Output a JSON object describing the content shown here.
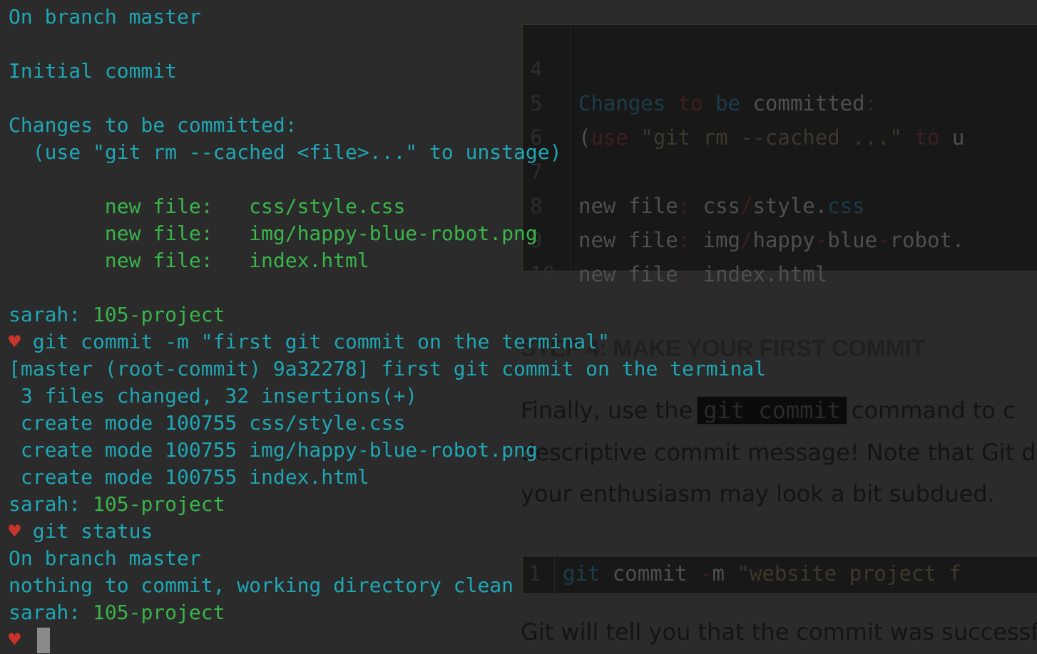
{
  "background_page": {
    "code_block_1": [
      {
        "num": "4",
        "text": ""
      },
      {
        "num": "5",
        "parts": [
          "Changes",
          " ",
          "to",
          " ",
          "be",
          " committed",
          ":"
        ]
      },
      {
        "num": "6",
        "parts": [
          "(",
          "use",
          " \"git rm --cached ...\" ",
          "to",
          " u"
        ]
      },
      {
        "num": "7",
        "text": ""
      },
      {
        "num": "8",
        "parts": [
          "new file",
          ":",
          " css",
          "/",
          "style.",
          "css"
        ]
      },
      {
        "num": "9",
        "parts": [
          "new file",
          ":",
          " img",
          "/",
          "happy",
          "-",
          "blue",
          "-",
          "robot."
        ]
      },
      {
        "num": "10",
        "parts": [
          "new file",
          ":",
          " index.html"
        ]
      }
    ],
    "heading": "STEP 4: MAKE YOUR FIRST COMMIT",
    "para_1_before": "Finally, use the",
    "inline_code": "git commit",
    "para_1_after": "command to c",
    "para_2": "descriptive commit message! Note that Git d",
    "para_3": "your enthusiasm may look a bit subdued.",
    "code_block_2": {
      "num": "1",
      "parts": [
        "git",
        " commit ",
        "-",
        "m ",
        "\"website project f"
      ]
    },
    "para_4": "Git will tell you that the commit was successf"
  },
  "terminal": {
    "lines": [
      {
        "parts": [
          {
            "t": "On branch master",
            "c": "cyan"
          }
        ]
      },
      {
        "parts": []
      },
      {
        "parts": [
          {
            "t": "Initial commit",
            "c": "cyan"
          }
        ]
      },
      {
        "parts": []
      },
      {
        "parts": [
          {
            "t": "Changes to be committed:",
            "c": "cyan"
          }
        ]
      },
      {
        "parts": [
          {
            "t": "  (use \"git rm --cached <file>...\" to unstage)",
            "c": "cyan"
          }
        ]
      },
      {
        "parts": []
      },
      {
        "parts": [
          {
            "t": "        new file:   css/style.css",
            "c": "green"
          }
        ]
      },
      {
        "parts": [
          {
            "t": "        new file:   img/happy-blue-robot.png",
            "c": "green"
          }
        ]
      },
      {
        "parts": [
          {
            "t": "        new file:   index.html",
            "c": "green"
          }
        ]
      },
      {
        "parts": []
      },
      {
        "parts": [
          {
            "t": "sarah: ",
            "c": "cyan"
          },
          {
            "t": "105-project",
            "c": "green"
          }
        ]
      },
      {
        "parts": [
          {
            "t": "♥",
            "c": "heart"
          },
          {
            "t": " git commit -m \"first git commit on the terminal\"",
            "c": "cyan"
          }
        ]
      },
      {
        "parts": [
          {
            "t": "[master (root-commit) 9a32278] first git commit on the terminal",
            "c": "cyan"
          }
        ]
      },
      {
        "parts": [
          {
            "t": " 3 files changed, 32 insertions(+)",
            "c": "cyan"
          }
        ]
      },
      {
        "parts": [
          {
            "t": " create mode 100755 css/style.css",
            "c": "cyan"
          }
        ]
      },
      {
        "parts": [
          {
            "t": " create mode 100755 img/happy-blue-robot.png",
            "c": "cyan"
          }
        ]
      },
      {
        "parts": [
          {
            "t": " create mode 100755 index.html",
            "c": "cyan"
          }
        ]
      },
      {
        "parts": [
          {
            "t": "sarah: ",
            "c": "cyan"
          },
          {
            "t": "105-project",
            "c": "green"
          }
        ]
      },
      {
        "parts": [
          {
            "t": "♥",
            "c": "heart"
          },
          {
            "t": " git status",
            "c": "cyan"
          }
        ]
      },
      {
        "parts": [
          {
            "t": "On branch master",
            "c": "cyan"
          }
        ]
      },
      {
        "parts": [
          {
            "t": "nothing to commit, working directory clean",
            "c": "cyan"
          }
        ]
      },
      {
        "parts": [
          {
            "t": "sarah: ",
            "c": "cyan"
          },
          {
            "t": "105-project",
            "c": "green"
          }
        ]
      },
      {
        "parts": [
          {
            "t": "♥",
            "c": "heart"
          },
          {
            "t": " ",
            "c": "cyan"
          }
        ],
        "cursor": true
      }
    ]
  },
  "colors": {
    "terminal_bg": "#2b2b2b",
    "cyan": "#1fa6b4",
    "green": "#39b54a",
    "heart": "#c8342a"
  }
}
